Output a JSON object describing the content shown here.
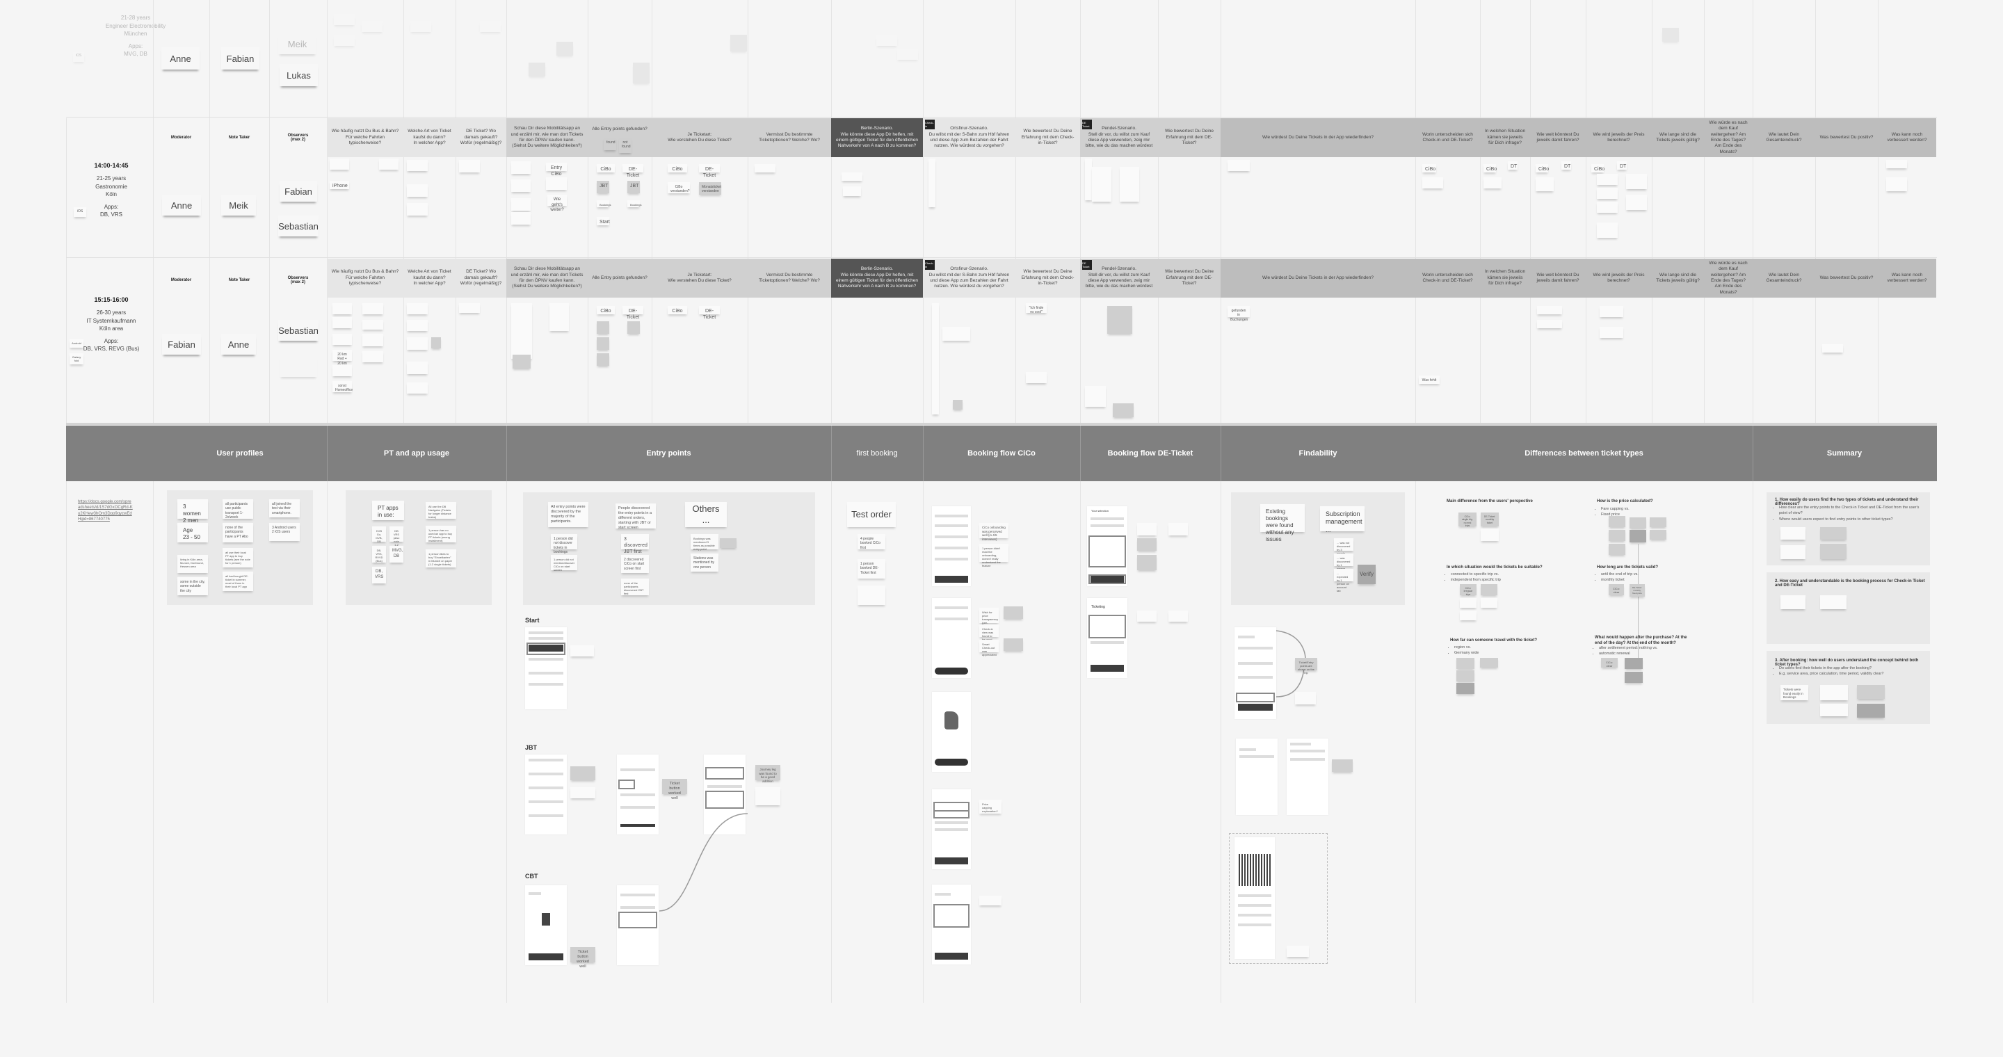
{
  "board": {
    "sessions_header": {
      "roles": [
        "Moderator",
        "Note Taker",
        "Observers\n(max 2)"
      ]
    },
    "faded_top_session": {
      "profile": [
        "21-28 years",
        "Engineer Electromobility",
        "München",
        "Apps:",
        "MVG, DB"
      ],
      "os_tag": "iOS",
      "moderator": "Anne",
      "note_taker": "Fabian",
      "observers": [
        "Meik",
        "Lukas"
      ]
    },
    "questions": [
      "Wie häufig nutzt Du Bus & Bahn?\nFür welche Fahrten typischerweise?",
      "Welche Art von Ticket kaufst du dann?\nIn welcher App?",
      "DE Ticket? Wo damals gekauft? Wofür (regelmäßig)?",
      "Schau Dir diese Mobilitätsapp an und erzähl mir, wie man dort Tickets für den ÖPNV kaufen kann.\n(Siehst Du weitere Möglichkeiten?)",
      "Alle Entry points gefunden?",
      "Je Ticketart:\nWie verstehen Du diese Ticket?",
      "Vermisst Du bestimmte Ticketoptionen? Welche? Wo?",
      "Berlin-Szenario.\nWie könnte diese App Dir helfen, mit einem gültigen Ticket für den öffentlichen Nahverkehr von A nach B zu kommen?",
      "Ortsfinur-Szenario.\nDu willst mit der S-Bahn zum Hbf fahren und diese App zum Bezahlen der Fahrt nutzen. Wie würdest du vorgehen?",
      "Wie bewertest Du Deine Erfahrung mit dem Check-in-Ticket?",
      "Pendel-Szenario.\nStell dir vor, du willst zum Kauf diese App verwenden, zeig mir bitte, wie du das machen würdest",
      "Wie bewertest Du Deine Erfahrung mit dem DE-Ticket?",
      "Wie würdest Du Deine Tickets in der App wiederfinden?",
      "Worin unterscheiden sich Check-in und DE-Ticket?",
      "In welchen Situation kämen sie jeweils für Dich infrage?",
      "Wie weit könntest Du jeweils damit fahren?",
      "Wie wird jeweils der Preis berechnet?",
      "Wie lange sind die Tickets jeweils gültig?",
      "Wie würde es nach dem Kauf weitergehen? Am Ende des Tages? Am Ende des Monats?",
      "Wie lautet Dein Gesamteindruck?",
      "Was bewertest Du positiv?",
      "Was kann noch verbessert werden?"
    ],
    "found_tags": [
      "found",
      "not found"
    ],
    "scenario_badges": [
      "Check-in",
      "DE Ticket"
    ],
    "sessions": [
      {
        "time": "14:00-14:45",
        "profile": [
          "21-25 years",
          "Gastronomie",
          "Köln",
          "Apps:",
          "DB, VRS"
        ],
        "os_tag": "iOS",
        "moderator": "Anne",
        "note_taker": "Meik",
        "observers": [
          "Fabian",
          "Sebastian"
        ],
        "notes": {
          "q1": [
            "iPhone"
          ],
          "q4": [
            "Entry CiBo",
            "Wie geht's weiter?"
          ],
          "q5": [
            "CiBo",
            "DE-Ticket",
            "JBT",
            "JBT",
            "Bookings",
            "Bookings",
            "Start"
          ],
          "q6": [
            "CiBo",
            "DE-Ticket",
            "CiBo verstanden?",
            "Monatsticket verstanden"
          ],
          "q14": [
            "CiBo"
          ],
          "q15": [
            "CiBo",
            "DT"
          ],
          "q16": [
            "CiBo",
            "DT"
          ],
          "q17": [
            "CiBo",
            "DT"
          ]
        }
      },
      {
        "time": "15:15-16:00",
        "profile": [
          "26-30 years",
          "IT Systemkaufmann",
          "Köln area",
          "Apps:",
          "DB, VRS, REVG (Bus)"
        ],
        "os_tag": "Android",
        "os_tag_2": "Galaxy fold",
        "moderator": "Fabian",
        "note_taker": "Anne",
        "observers": [
          "Sebastian"
        ],
        "notes": {
          "q1": [
            "20 km Rad + 20 km Zug",
            "sonst Homeoffice"
          ],
          "q5": [
            "CiBo",
            "DE-Ticket"
          ],
          "q6": [
            "CiBo",
            "DE-Ticket"
          ],
          "q10": [
            "\"Ich finde es cool\""
          ],
          "q13": [
            "gefunden in Buchungen"
          ],
          "q13b": [
            "Was fehlt"
          ]
        }
      }
    ],
    "sections": [
      "User profiles",
      "PT and app usage",
      "Entry points",
      "first booking",
      "Booking flow CiCo",
      "Booking flow DE-Ticket",
      "Findability",
      "Differences between ticket types",
      "Summary"
    ],
    "user_profiles": {
      "link": "https://docs.google.com/spreadsheets/d/1S7dGxOCgRd-Ku2KHew3hOm3Dpp9qyzwEdHgid=867740775",
      "stickies": [
        "3 women\n2 men",
        "Age\n23 - 50",
        "all participants use public transport 1-2x/week",
        "none of the participants have a PT Abo",
        "all joined the test via their smartphone.",
        "3 Android users\n2 iOS users",
        "all use their local PT app to buy tickets (see the note for 1 person)",
        "all had bought DE-ticket in summer, most of them in their local PT app",
        "living in Köln area, Munich, Dortmund, Hessen area",
        "some in the city, some outside the city"
      ]
    },
    "pt_usage": {
      "title": "PT apps in use:",
      "stickies": [
        "KVB Go, DVB, DB",
        "DB VRS (also note 1-2 times)",
        "DB, VRS, RVVD (Bus)",
        "MVG, DB",
        "DB, VRS"
      ],
      "notes": [
        "All use the DB Navigator (Tickets for longer distance trains)",
        "1 person has no used an app to buy PT tickets (wrong installment)",
        "1 person likes to buy \"Einzelkarten\" in Munich on paper (1-2 single tickets)"
      ]
    },
    "entry_points": {
      "stickies": [
        "All entry points were discovered by the majority of the participants.",
        "People discovered the entry points in a different orders, starting with JBT or start screen",
        "Others ...",
        "1 person did not discover tickets in bookings",
        "1 person did not mention/discover CiCo on start screen",
        "3 discovered JBT first",
        "2 discovered CiCo on start screen first",
        "none of the participants discovered CBT first",
        "Bookings was mentioned 3 times as possible entry point",
        "Stations was mentioned by one person"
      ],
      "flows": [
        "Start",
        "JBT",
        "CBT"
      ],
      "notes": [
        "Ticket button worked well",
        "Ticket button worked well",
        "Journey leg was found to be a good addition"
      ]
    },
    "first_booking": {
      "title": "Test order",
      "stickies": [
        "4 people booked CiCo first",
        "1 person booked DE-Ticket first"
      ]
    },
    "booking_cico": {
      "notes": [
        "CiCo onboarding was perceived well (in 4/5 interviews)",
        "1 person didn't read the onboarding, doesn't really understand the feature",
        "Wish for price transparency (pre-calculated)",
        "Check-in view was found to be good",
        "Smart Check-out was appreciated",
        "Price capping explanation?"
      ]
    },
    "booking_de": {
      "title": "Your selection",
      "screen2": "Ticketing"
    },
    "findability": {
      "stickies": [
        "Existing bookings were found without any issues",
        "Subscription management ...",
        "... was not discovered by 3 people",
        "... was discovered by 1 person",
        "... expected by 1 person on account tab"
      ],
      "verify": "Verify",
      "note": "Ticket/Entry points are shown on the trip"
    },
    "differences": {
      "questions": [
        {
          "title": "Main difference from the users' perspective",
          "items": []
        },
        {
          "title": "How is the price calculated?",
          "items": [
            "Fare capping vs.",
            "Fixed price"
          ]
        },
        {
          "title": "In which situation would the tickets be suitable?",
          "items": [
            "connected to specific trip vs.",
            "independent from specific trip"
          ]
        },
        {
          "title": "How long are the tickets valid?",
          "items": [
            "until the end of trip vs.",
            "monthly ticket"
          ]
        },
        {
          "title": "How far can someone travel with the ticket?",
          "items": [
            "region vs.",
            "Germany wide"
          ]
        },
        {
          "title": "What would happen after the purchase? At the end of the day? At the end of the month?",
          "items": [
            "after settlement period: nothing vs.",
            "automatic renewal"
          ]
        }
      ],
      "stickies": [
        "CiCo: single trip, no end trips",
        "DE-Ticket: monthly ticket",
        "CiCo: irregular trips",
        "CiCo: clear",
        "DE-Ticket: monthly, fixed price"
      ]
    },
    "summary": {
      "questions": [
        {
          "title": "1. How easily do users find the two types of tickets and understand their differences?",
          "items": [
            "How clear are the entry points to the Check-in Ticket and DE-Ticket from the user's point of view?",
            "Where would users expect to find entry points to other ticket types?"
          ]
        },
        {
          "title": "2. How easy and understandable is the booking process for Check-in Ticket and DE-Ticket",
          "items": []
        },
        {
          "title": "3. After booking: how well do users understand the concept behind both ticket types?",
          "items": [
            "Do users find their tickets in the app after the booking?",
            "E.g. service area, price calculation, time period, validity clear?"
          ]
        }
      ],
      "stickies": [
        "Tickets were found easily in Bookings"
      ]
    }
  }
}
